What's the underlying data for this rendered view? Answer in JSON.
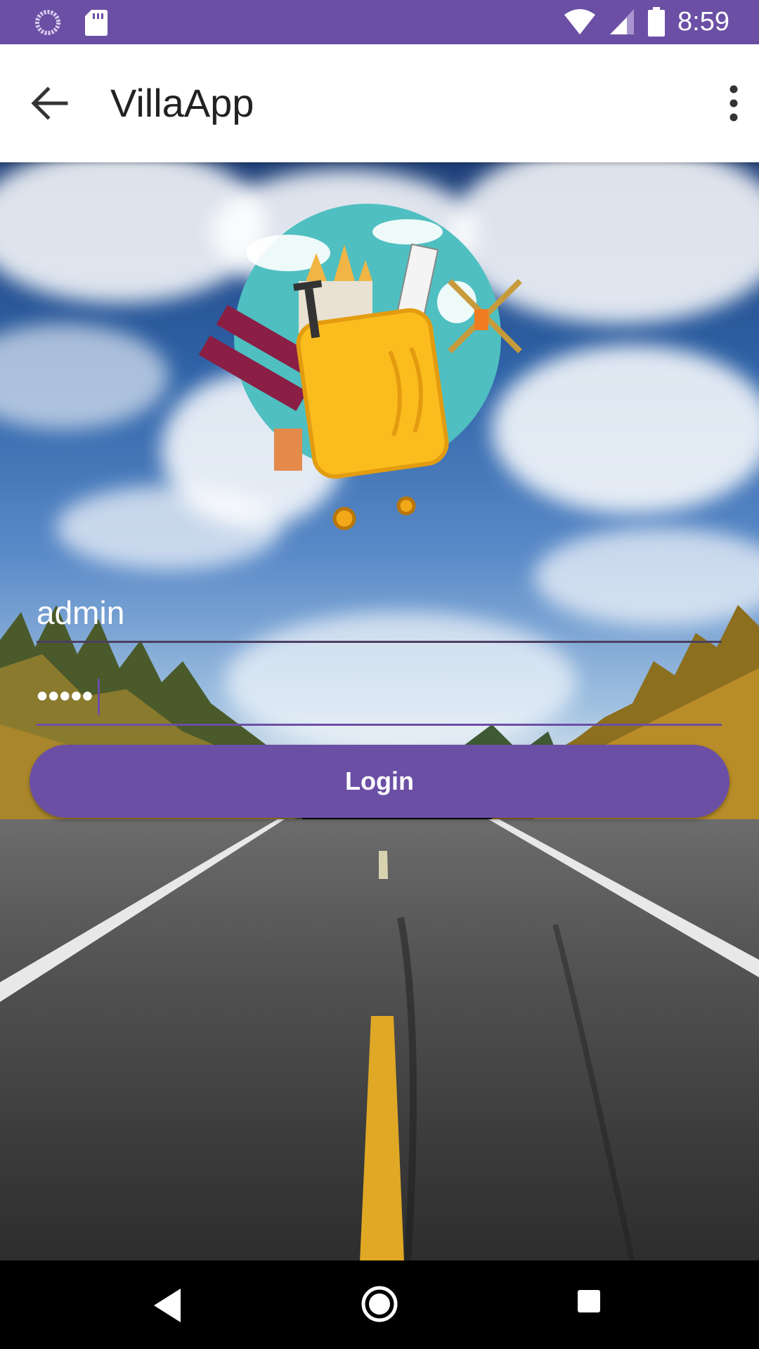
{
  "status_bar": {
    "time": "8:59",
    "left_icons": [
      "sync-icon",
      "sd-card-icon"
    ],
    "right_icons": [
      "wifi-icon",
      "signal-icon",
      "battery-icon"
    ]
  },
  "app_bar": {
    "title": "VillaApp",
    "back_icon": "arrow-back-icon",
    "menu_icon": "more-vert-icon"
  },
  "login": {
    "username_value": "admin",
    "password_value": "•••••",
    "button_label": "Login"
  },
  "colors": {
    "primary": "#6b4fa5",
    "suitcase": "#fbbd1e",
    "globe": "#4fbfc1"
  },
  "nav_bar": {
    "icons": [
      "nav-back-icon",
      "nav-home-icon",
      "nav-recents-icon"
    ]
  }
}
